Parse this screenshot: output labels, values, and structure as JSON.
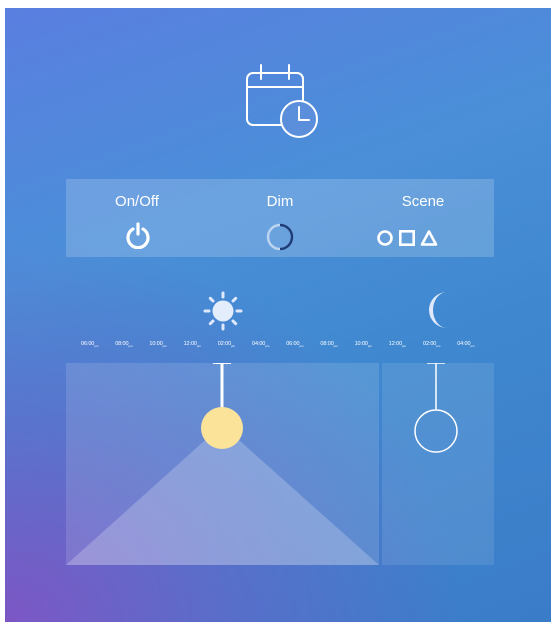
{
  "modes": {
    "onoff": {
      "label": "On/Off"
    },
    "dim": {
      "label": "Dim"
    },
    "scene": {
      "label": "Scene"
    }
  },
  "timeline": {
    "ticks": [
      {
        "time": "06:00",
        "suffix": "pm"
      },
      {
        "time": "08:00",
        "suffix": "pm"
      },
      {
        "time": "10:00",
        "suffix": "pm"
      },
      {
        "time": "12:00",
        "suffix": "pm"
      },
      {
        "time": "02:00",
        "suffix": "pm"
      },
      {
        "time": "04:00",
        "suffix": "pm"
      },
      {
        "time": "06:00",
        "suffix": "pm"
      },
      {
        "time": "08:00",
        "suffix": "pm"
      },
      {
        "time": "10:00",
        "suffix": "pm"
      },
      {
        "time": "12:00",
        "suffix": "pm"
      },
      {
        "time": "02:00",
        "suffix": "pm"
      },
      {
        "time": "04:00",
        "suffix": "pm"
      }
    ]
  },
  "icons": {
    "header": "calendar-clock-icon",
    "onoff": "power-icon",
    "dim": "dim-ring-icon",
    "scene": [
      "circle-icon",
      "square-icon",
      "triangle-icon"
    ],
    "day": "sun-icon",
    "night": "moon-icon"
  },
  "colors": {
    "bulb_on": "#fbe49a",
    "accent": "#ffffff"
  }
}
